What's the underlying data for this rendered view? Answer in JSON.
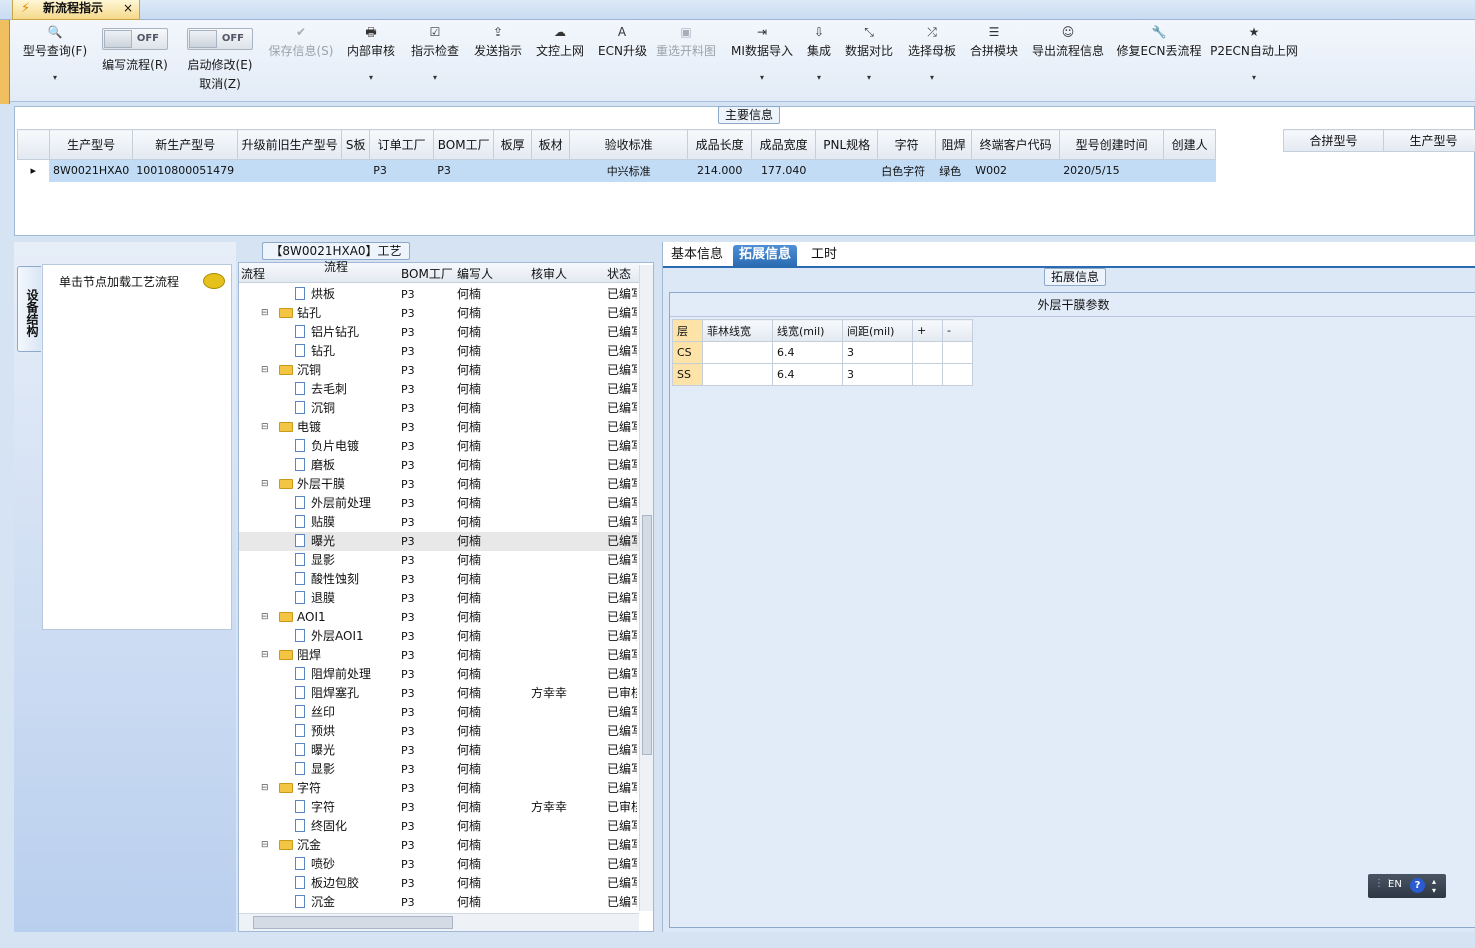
{
  "window": {
    "tab_title": "新流程指示",
    "tab_close": "×"
  },
  "toolbar": {
    "items": [
      {
        "label": "型号查询(F)",
        "icon": "search-icon",
        "glyph": "🔍"
      },
      {
        "label": "编写流程(R)",
        "toggle": "OFF"
      },
      {
        "label": "启动修改(E)",
        "sub": "取消(Z)",
        "toggle": "OFF"
      },
      {
        "label": "保存信息(S)",
        "icon": "check-icon",
        "glyph": "✔",
        "disabled": true
      },
      {
        "label": "内部审核",
        "icon": "printer-icon",
        "glyph": "🖶"
      },
      {
        "label": "指示检查",
        "icon": "checkbox-icon",
        "glyph": "☑"
      },
      {
        "label": "发送指示",
        "icon": "upload-icon",
        "glyph": "⇪"
      },
      {
        "label": "文控上网",
        "icon": "cloud-upload-icon",
        "glyph": "☁"
      },
      {
        "label": "ECN升级",
        "icon": "font-icon",
        "glyph": "A"
      },
      {
        "label": "重选开料图",
        "icon": "image-icon",
        "glyph": "▣",
        "disabled": true
      },
      {
        "label": "MI数据导入",
        "icon": "import-icon",
        "glyph": "⇥"
      },
      {
        "label": "集成",
        "icon": "download-icon",
        "glyph": "⇩"
      },
      {
        "label": "数据对比",
        "icon": "compress-icon",
        "glyph": "⤡"
      },
      {
        "label": "选择母板",
        "icon": "shuffle-icon",
        "glyph": "⤮"
      },
      {
        "label": "合拼模块",
        "icon": "list-icon",
        "glyph": "☰"
      },
      {
        "label": "导出流程信息",
        "icon": "smile-icon",
        "glyph": "☺"
      },
      {
        "label": "修复ECN丢流程",
        "icon": "wrench-icon",
        "glyph": "🔧"
      },
      {
        "label": "P2ECN自动上网",
        "icon": "star-icon",
        "glyph": "★"
      }
    ]
  },
  "main_info": {
    "caption": "主要信息",
    "columns": [
      "生产型号",
      "新生产型号",
      "升级前旧生产型号",
      "S板",
      "订单工厂",
      "BOM工厂",
      "板厚",
      "板材",
      "验收标准",
      "成品长度",
      "成品宽度",
      "PNL规格",
      "字符",
      "阻焊",
      "终端客户代码",
      "型号创建时间",
      "创建人"
    ],
    "rows": [
      [
        "8W0021HXA0",
        "10010800051479",
        "",
        "",
        "P3",
        "P3",
        "",
        "",
        "中兴标准",
        "214.000",
        "177.040",
        "",
        "白色字符",
        "绿色",
        "W002",
        "2020/5/15",
        ""
      ]
    ],
    "merge_columns": [
      "合拼型号",
      "生产型号"
    ]
  },
  "left": {
    "vtab": "设备结构",
    "hint": "单击节点加载工艺流程"
  },
  "process": {
    "caption": "【8W0021HXA0】工艺流程",
    "columns": [
      "流程",
      "BOM工厂",
      "编写人",
      "核审人",
      "状态"
    ],
    "rows": [
      {
        "level": 2,
        "name": "烘板",
        "bom": "P3",
        "writer": "何楠",
        "reviewer": "",
        "status": "已编写"
      },
      {
        "level": 1,
        "name": "钻孔",
        "bom": "P3",
        "writer": "何楠",
        "reviewer": "",
        "status": "已编写"
      },
      {
        "level": 2,
        "name": "铝片钻孔",
        "bom": "P3",
        "writer": "何楠",
        "reviewer": "",
        "status": "已编写"
      },
      {
        "level": 2,
        "name": "钻孔",
        "bom": "P3",
        "writer": "何楠",
        "reviewer": "",
        "status": "已编写"
      },
      {
        "level": 1,
        "name": "沉铜",
        "bom": "P3",
        "writer": "何楠",
        "reviewer": "",
        "status": "已编写"
      },
      {
        "level": 2,
        "name": "去毛刺",
        "bom": "P3",
        "writer": "何楠",
        "reviewer": "",
        "status": "已编写"
      },
      {
        "level": 2,
        "name": "沉铜",
        "bom": "P3",
        "writer": "何楠",
        "reviewer": "",
        "status": "已编写"
      },
      {
        "level": 1,
        "name": "电镀",
        "bom": "P3",
        "writer": "何楠",
        "reviewer": "",
        "status": "已编写"
      },
      {
        "level": 2,
        "name": "负片电镀",
        "bom": "P3",
        "writer": "何楠",
        "reviewer": "",
        "status": "已编写"
      },
      {
        "level": 2,
        "name": "磨板",
        "bom": "P3",
        "writer": "何楠",
        "reviewer": "",
        "status": "已编写"
      },
      {
        "level": 1,
        "name": "外层干膜",
        "bom": "P3",
        "writer": "何楠",
        "reviewer": "",
        "status": "已编写"
      },
      {
        "level": 2,
        "name": "外层前处理",
        "bom": "P3",
        "writer": "何楠",
        "reviewer": "",
        "status": "已编写"
      },
      {
        "level": 2,
        "name": "贴膜",
        "bom": "P3",
        "writer": "何楠",
        "reviewer": "",
        "status": "已编写"
      },
      {
        "level": 2,
        "name": "曝光",
        "bom": "P3",
        "writer": "何楠",
        "reviewer": "",
        "status": "已编写",
        "selected": true
      },
      {
        "level": 2,
        "name": "显影",
        "bom": "P3",
        "writer": "何楠",
        "reviewer": "",
        "status": "已编写"
      },
      {
        "level": 2,
        "name": "酸性蚀刻",
        "bom": "P3",
        "writer": "何楠",
        "reviewer": "",
        "status": "已编写"
      },
      {
        "level": 2,
        "name": "退膜",
        "bom": "P3",
        "writer": "何楠",
        "reviewer": "",
        "status": "已编写"
      },
      {
        "level": 1,
        "name": "AOI1",
        "bom": "P3",
        "writer": "何楠",
        "reviewer": "",
        "status": "已编写"
      },
      {
        "level": 2,
        "name": "外层AOI1",
        "bom": "P3",
        "writer": "何楠",
        "reviewer": "",
        "status": "已编写"
      },
      {
        "level": 1,
        "name": "阻焊",
        "bom": "P3",
        "writer": "何楠",
        "reviewer": "",
        "status": "已编写"
      },
      {
        "level": 2,
        "name": "阻焊前处理",
        "bom": "P3",
        "writer": "何楠",
        "reviewer": "",
        "status": "已编写"
      },
      {
        "level": 2,
        "name": "阻焊塞孔",
        "bom": "P3",
        "writer": "何楠",
        "reviewer": "方幸幸",
        "status": "已审核"
      },
      {
        "level": 2,
        "name": "丝印",
        "bom": "P3",
        "writer": "何楠",
        "reviewer": "",
        "status": "已编写"
      },
      {
        "level": 2,
        "name": "预烘",
        "bom": "P3",
        "writer": "何楠",
        "reviewer": "",
        "status": "已编写"
      },
      {
        "level": 2,
        "name": "曝光",
        "bom": "P3",
        "writer": "何楠",
        "reviewer": "",
        "status": "已编写"
      },
      {
        "level": 2,
        "name": "显影",
        "bom": "P3",
        "writer": "何楠",
        "reviewer": "",
        "status": "已编写"
      },
      {
        "level": 1,
        "name": "字符",
        "bom": "P3",
        "writer": "何楠",
        "reviewer": "",
        "status": "已编写"
      },
      {
        "level": 2,
        "name": "字符",
        "bom": "P3",
        "writer": "何楠",
        "reviewer": "方幸幸",
        "status": "已审核"
      },
      {
        "level": 2,
        "name": "终固化",
        "bom": "P3",
        "writer": "何楠",
        "reviewer": "",
        "status": "已编写"
      },
      {
        "level": 1,
        "name": "沉金",
        "bom": "P3",
        "writer": "何楠",
        "reviewer": "",
        "status": "已编写"
      },
      {
        "level": 2,
        "name": "喷砂",
        "bom": "P3",
        "writer": "何楠",
        "reviewer": "",
        "status": "已编写"
      },
      {
        "level": 2,
        "name": "板边包胶",
        "bom": "P3",
        "writer": "何楠",
        "reviewer": "",
        "status": "已编写"
      },
      {
        "level": 2,
        "name": "沉金",
        "bom": "P3",
        "writer": "何楠",
        "reviewer": "",
        "status": "已编写"
      }
    ]
  },
  "right": {
    "tabs": [
      "基本信息",
      "拓展信息",
      "工时"
    ],
    "active_tab": 1,
    "caption": "拓展信息",
    "table_title": "外层干膜参数",
    "columns": [
      "层",
      "菲林线宽",
      "线宽(mil)",
      "间距(mil)",
      "+",
      "-"
    ],
    "rows": [
      [
        "CS",
        "",
        "6.4",
        "3",
        "",
        ""
      ],
      [
        "SS",
        "",
        "6.4",
        "3",
        "",
        ""
      ]
    ]
  },
  "ime": {
    "lang": "EN",
    "help": "?"
  }
}
